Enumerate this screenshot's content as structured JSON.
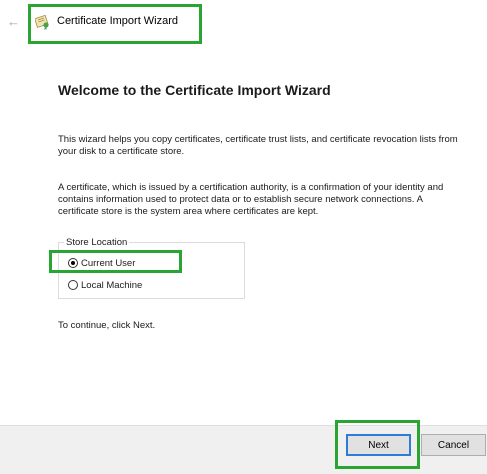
{
  "window": {
    "title": "Certificate Import Wizard",
    "back_icon": "back-arrow-icon",
    "title_icon": "certificate-icon"
  },
  "main": {
    "heading": "Welcome to the Certificate Import Wizard",
    "paragraph1": "This wizard helps you copy certificates, certificate trust lists, and certificate revocation lists from your disk to a certificate store.",
    "paragraph2": "A certificate, which is issued by a certification authority, is a confirmation of your identity and contains information used to protect data or to establish secure network connections. A certificate store is the system area where certificates are kept.",
    "store_location": {
      "legend": "Store Location",
      "options": [
        {
          "label": "Current User",
          "selected": true
        },
        {
          "label": "Local Machine",
          "selected": false
        }
      ]
    },
    "continue_text": "To continue, click Next."
  },
  "footer": {
    "next_label": "Next",
    "cancel_label": "Cancel"
  },
  "colors": {
    "highlight": "#2aa533",
    "default_button_border": "#2f7bd8"
  }
}
